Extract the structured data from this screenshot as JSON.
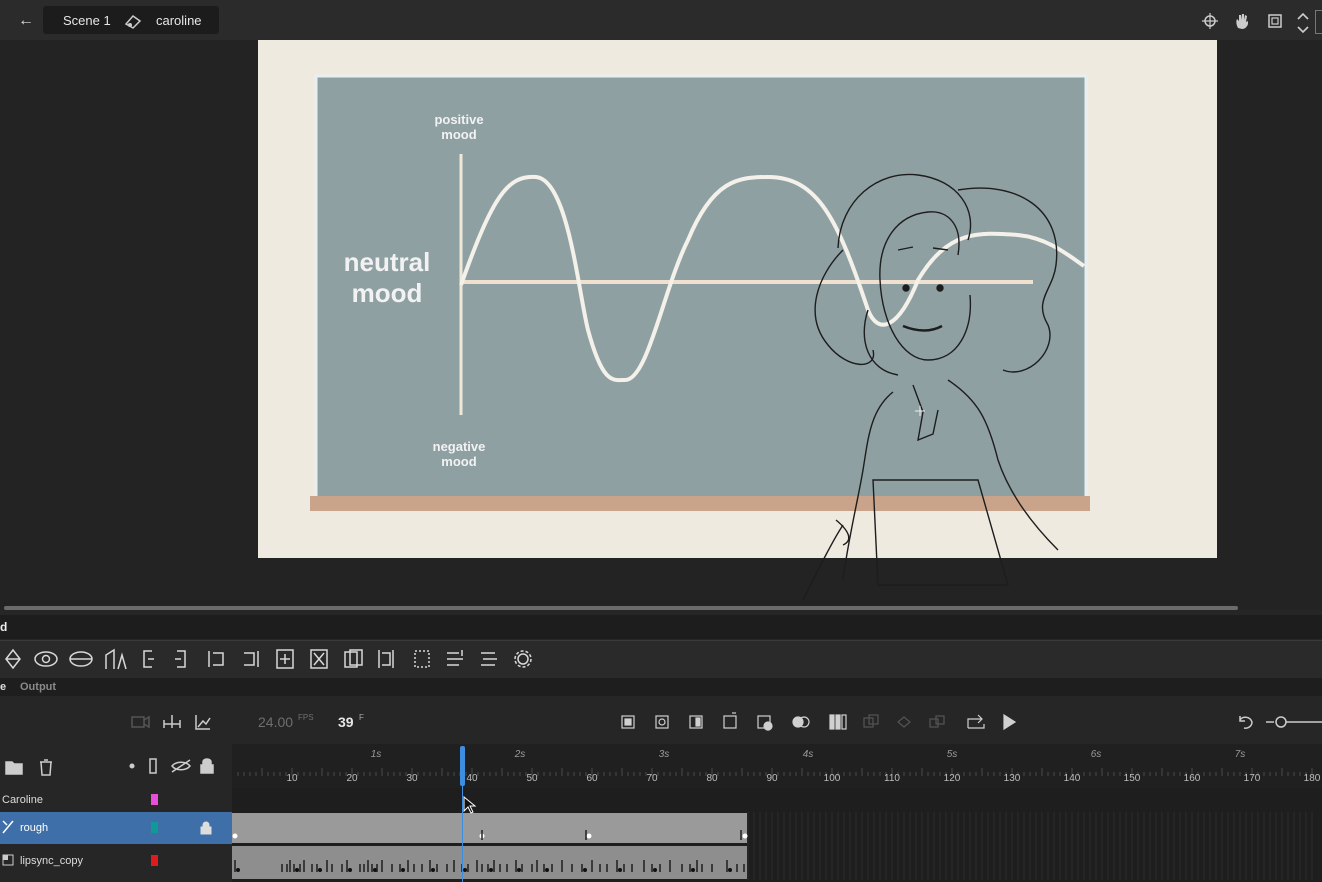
{
  "topbar": {
    "scene": "Scene 1",
    "symbol": "caroline"
  },
  "stage": {
    "board": {
      "positive_label": "positive\nmood",
      "neutral_label": "neutral\nmood",
      "negative_label": "negative\nmood"
    }
  },
  "panel": {
    "title": "d",
    "tabs": [
      "e",
      "Output"
    ]
  },
  "timeline": {
    "fps": "24.00",
    "fps_unit": "FPS",
    "current_frame": "39",
    "frame_unit": "F",
    "seconds": [
      "1s",
      "2s",
      "3s",
      "4s",
      "5s",
      "6s",
      "7s"
    ],
    "frame_numbers": [
      "10",
      "20",
      "30",
      "40",
      "50",
      "60",
      "70",
      "80",
      "90",
      "100",
      "110",
      "120",
      "130",
      "140",
      "150",
      "160",
      "170",
      "180"
    ],
    "layers": [
      {
        "name": "Caroline",
        "color": "#e84fd6"
      },
      {
        "name": "rough",
        "color": "#0f9a96",
        "selected": true,
        "locked": true
      },
      {
        "name": "lipsync_copy",
        "color": "#e01b1b"
      }
    ]
  },
  "colors": {
    "board": "#8fa0a3",
    "paper": "#efeae0",
    "ledge": "#c9a38a",
    "playhead": "#3d8ee0",
    "selection": "#3f6fa8"
  }
}
